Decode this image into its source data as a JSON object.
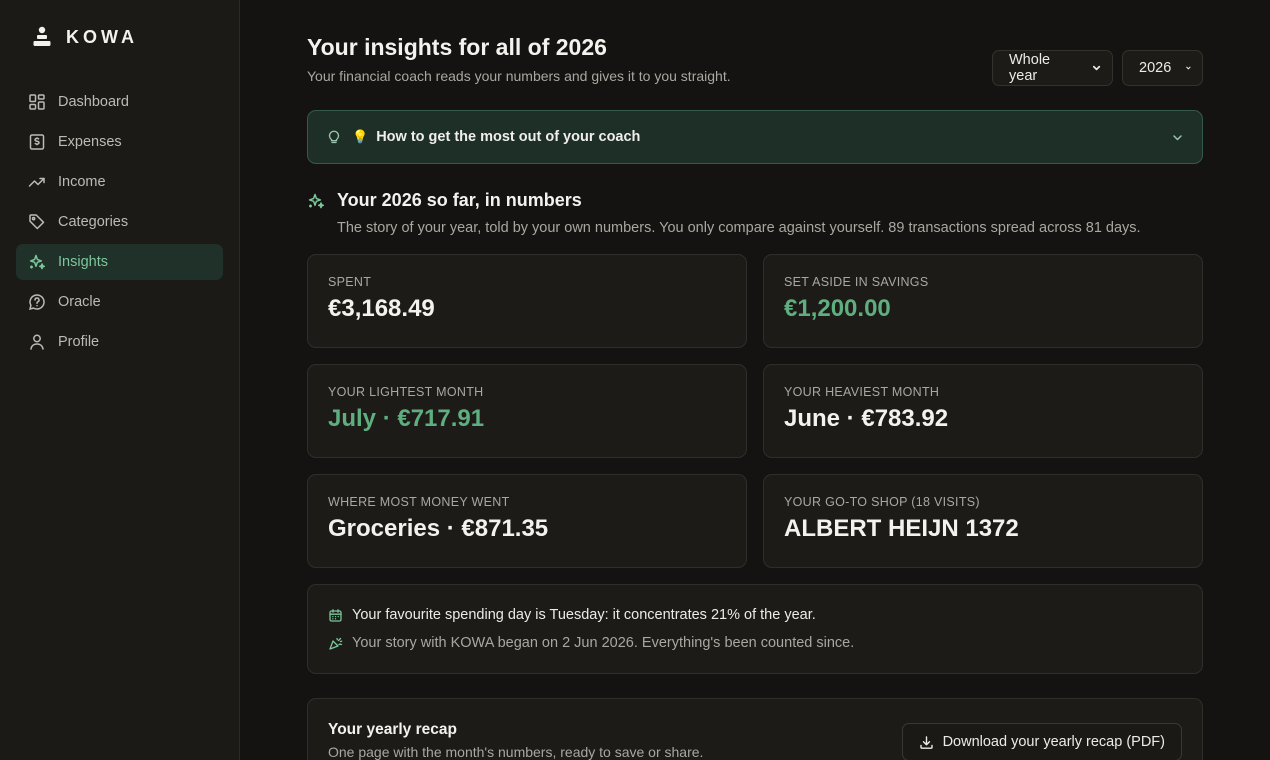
{
  "app": {
    "brand": "KOWA"
  },
  "sidebar": {
    "items": [
      {
        "label": "Dashboard",
        "icon": "grid-icon"
      },
      {
        "label": "Expenses",
        "icon": "receipt-dollar-icon"
      },
      {
        "label": "Income",
        "icon": "trending-up-icon"
      },
      {
        "label": "Categories",
        "icon": "tag-icon"
      },
      {
        "label": "Insights",
        "icon": "sparkles-icon",
        "active": true
      },
      {
        "label": "Oracle",
        "icon": "help-circle-icon"
      },
      {
        "label": "Profile",
        "icon": "user-icon"
      }
    ]
  },
  "header": {
    "title": "Your insights for all of 2026",
    "subtitle": "Your financial coach reads your numbers and gives it to you straight.",
    "period_select": "Whole year",
    "year_select": "2026"
  },
  "coach_banner": {
    "emoji": "💡",
    "label": "How to get the most out of your coach"
  },
  "numbers_section": {
    "title": "Your 2026 so far, in numbers",
    "subtitle": "The story of your year, told by your own numbers. You only compare against yourself. 89 transactions spread across 81 days."
  },
  "stats": [
    {
      "label": "Spent",
      "value": "€3,168.49",
      "accent": false
    },
    {
      "label": "Set aside in savings",
      "value": "€1,200.00",
      "accent": true
    },
    {
      "label": "Your lightest month",
      "value": "July · €717.91",
      "accent": true
    },
    {
      "label": "Your heaviest month",
      "value": "June · €783.92",
      "accent": false
    },
    {
      "label": "Where most money went",
      "value": "Groceries · €871.35",
      "accent": false
    },
    {
      "label": "Your go-to shop (18 visits)",
      "value": "ALBERT HEIJN 1372",
      "accent": false
    }
  ],
  "facts": {
    "spending_day": "Your favourite spending day is Tuesday: it concentrates 21% of the year.",
    "story_start": "Your story with KOWA began on 2 Jun 2026. Everything's been counted since."
  },
  "recap": {
    "title": "Your yearly recap",
    "subtitle": "One page with the month's numbers, ready to save or share.",
    "button_label": "Download your yearly recap (PDF)"
  },
  "colors": {
    "accent": "#7cc79c",
    "accent_value": "#5fae80",
    "background": "#141311",
    "sidebar": "#1b1a17",
    "card": "#1c1b18",
    "banner": "#1e2f28"
  }
}
